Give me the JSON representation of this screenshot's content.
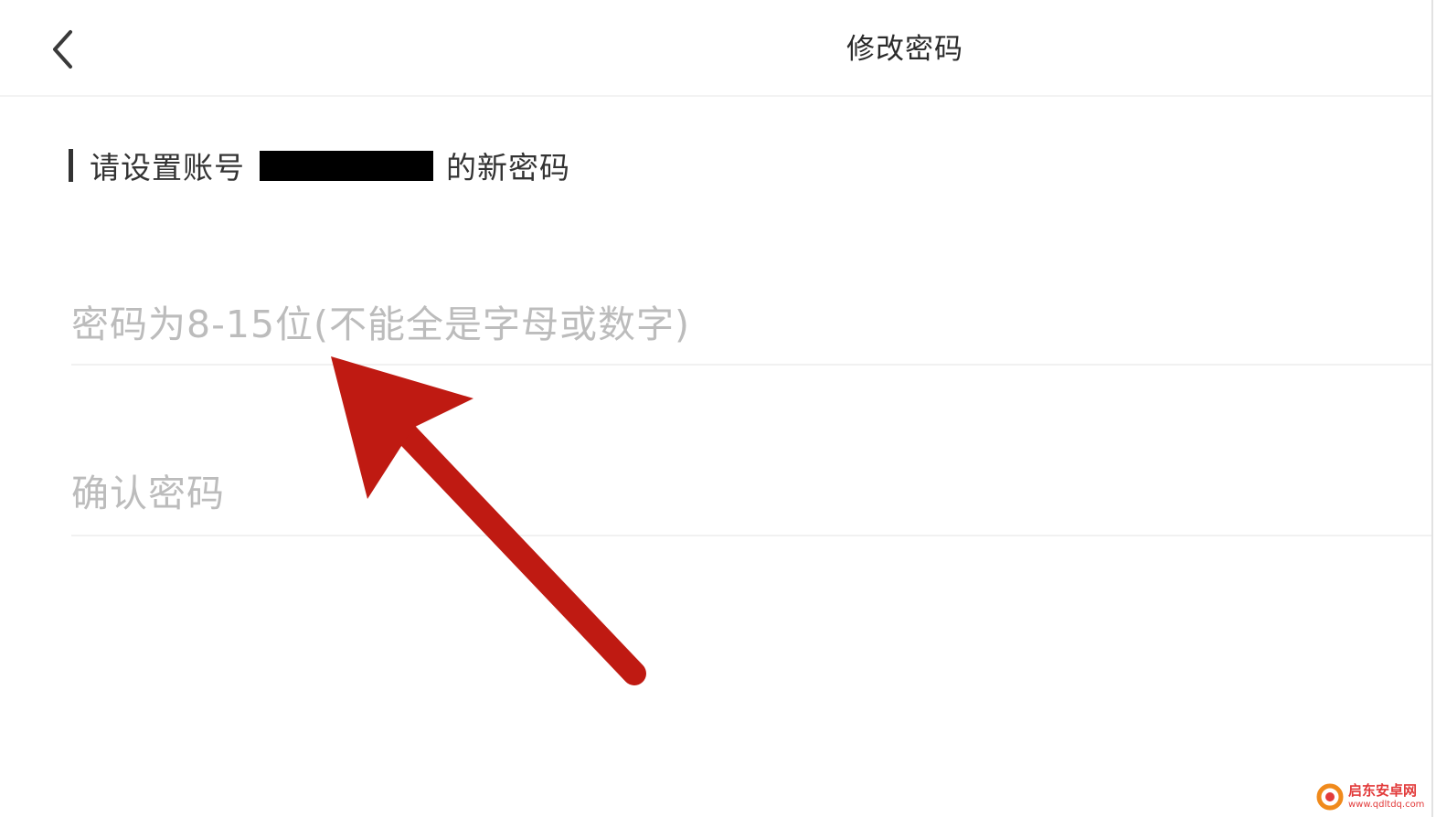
{
  "header": {
    "back_icon": "chevron-left-icon",
    "title": "修改密码"
  },
  "prompt": {
    "prefix": "请设置账号",
    "account_redacted": true,
    "suffix": "的新密码"
  },
  "form": {
    "password_placeholder": "密码为8-15位(不能全是字母或数字)",
    "password_value": "",
    "confirm_placeholder": "确认密码",
    "confirm_value": ""
  },
  "annotation": {
    "type": "arrow",
    "color": "#bf1a12"
  },
  "watermark": {
    "title": "启东安卓网",
    "url": "www.qdltdq.com"
  },
  "colors": {
    "background": "#ffffff",
    "placeholder": "#bcbcbc",
    "divider": "#f1f1f1",
    "arrow": "#bf1a12",
    "watermark": "#e23b3b"
  }
}
